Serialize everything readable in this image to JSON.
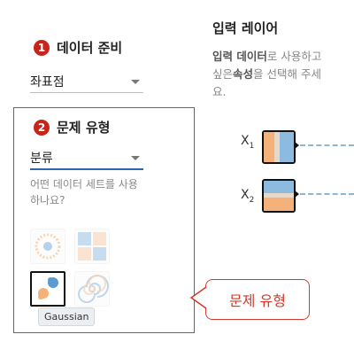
{
  "data_panel": {
    "step1_number": "1",
    "step1_title": "데이터 준비",
    "data_select_value": "좌표점",
    "step2_number": "2",
    "step2_title": "문제 유형",
    "problem_select_value": "분류",
    "hint": "어떤 데이터 세트를 사용하나요?",
    "datasets": [
      "circle",
      "xor",
      "gaussian",
      "spiral"
    ],
    "tooltip": "Gaussian"
  },
  "input_panel": {
    "title": "입력 레이어",
    "desc_part1": "입력 데이터",
    "desc_part2": "로 사용하고 싶은",
    "desc_part3": "속성",
    "desc_part4": "을 선택해 주세요.",
    "features": [
      {
        "name": "X",
        "sub": "1"
      },
      {
        "name": "X",
        "sub": "2"
      }
    ]
  },
  "callout": {
    "label": "문제 유형"
  },
  "colors": {
    "accent": "#2b67b2",
    "highlight": "#d33a2c",
    "badge": "#c9241b",
    "positive": "#f4b27a",
    "negative": "#5a9bd4"
  }
}
